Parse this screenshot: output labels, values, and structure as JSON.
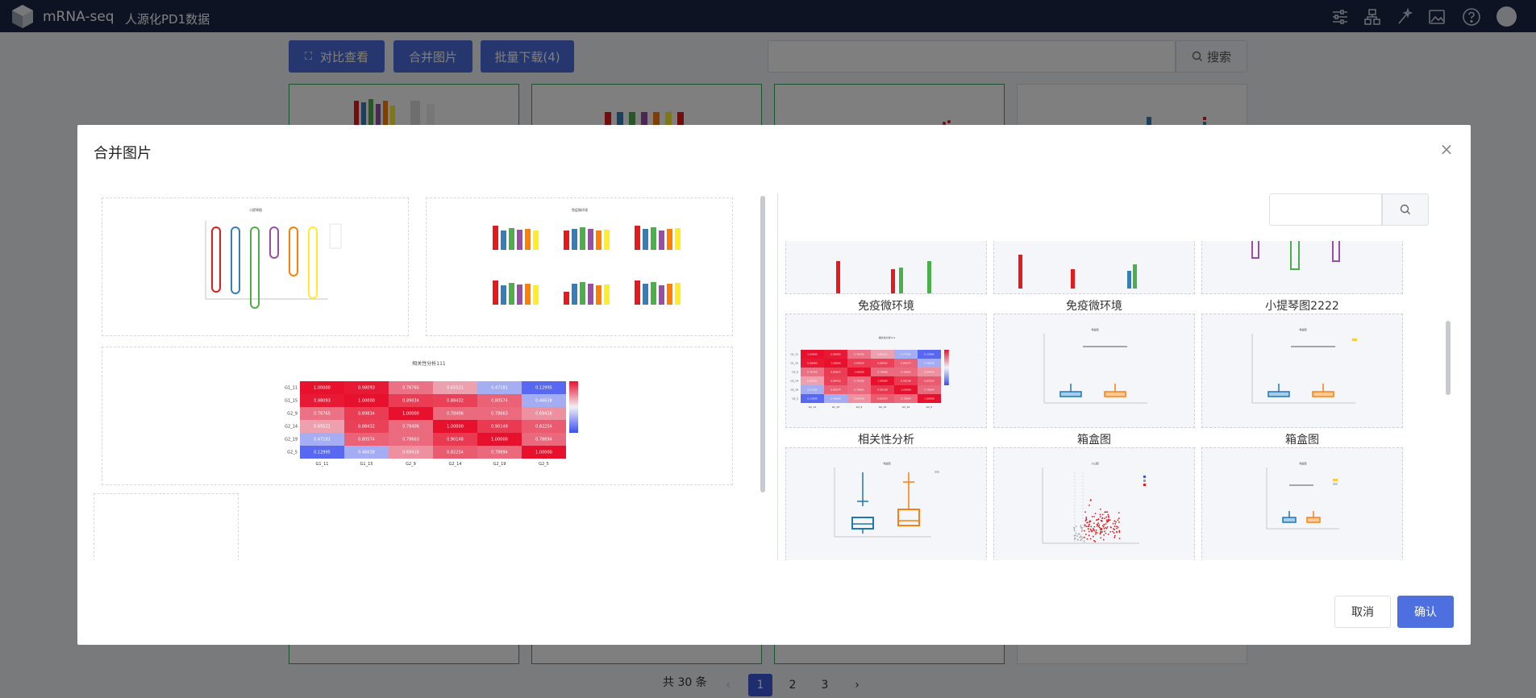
{
  "topbar": {
    "app_name": "mRNA-seq",
    "project_name": "人源化PD1数据",
    "icons": [
      "sliders-icon",
      "hierarchy-icon",
      "wand-icon",
      "image-icon",
      "help-icon",
      "avatar"
    ]
  },
  "toolbar": {
    "compare_label": "对比查看",
    "merge_label": "合并图片",
    "download_label": "批量下载(4)",
    "search_button": "搜索",
    "search_placeholder": ""
  },
  "pagination": {
    "total_text": "共 30 条",
    "pages": [
      "1",
      "2",
      "3"
    ],
    "current": "1"
  },
  "modal": {
    "title": "合并图片",
    "search_placeholder": "",
    "cancel_label": "取消",
    "confirm_label": "确认",
    "merge_cells": [
      {
        "title": "小提琴图"
      },
      {
        "title": "免疫微环境"
      },
      {
        "title": "相关性分析111"
      }
    ],
    "gallery_labels_row1": [
      "免疫微环境",
      "免疫微环境",
      "小提琴图2222"
    ],
    "gallery_labels_row2": [
      "相关性分析",
      "箱盒图",
      "箱盒图"
    ],
    "gallery_titles_row2": [
      "相关性分析111",
      "箱盒图",
      "箱盒图"
    ],
    "gallery_titles_row3": [
      "箱盒图",
      "火山图",
      "箱盒图"
    ],
    "heatmap_rows": [
      "G1_11",
      "G1_15",
      "G2_9",
      "G2_14",
      "G2_19",
      "G2_5"
    ],
    "heatmap_values": [
      [
        "1.00000",
        "0.98093",
        "0.76765",
        "0.65521",
        "0.47181",
        "0.12995"
      ],
      [
        "0.98093",
        "1.00000",
        "0.89834",
        "0.88432",
        "0.80574",
        "0.46638"
      ],
      [
        "0.76765",
        "0.89834",
        "1.00000",
        "0.78406",
        "0.78663",
        "0.69416"
      ],
      [
        "0.65521",
        "0.88432",
        "0.78406",
        "1.00000",
        "0.90148",
        "0.82254"
      ],
      [
        "0.47181",
        "0.80574",
        "0.78663",
        "0.90148",
        "1.00000",
        "0.78894"
      ],
      [
        "0.12995",
        "0.46638",
        "0.69416",
        "0.82254",
        "0.78894",
        "1.00000"
      ]
    ],
    "colors": {
      "accent": "#4d6fe0",
      "header_bg": "#1d2748",
      "heat_high": "#e8112d",
      "heat_low": "#3a4ef0"
    }
  }
}
